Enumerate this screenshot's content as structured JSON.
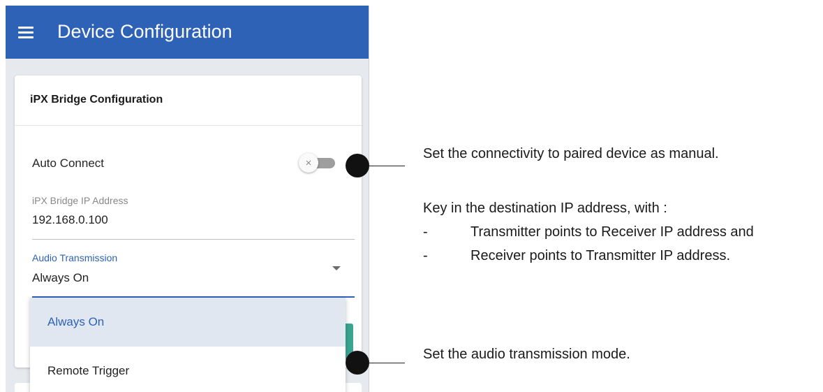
{
  "appbar": {
    "title": "Device Configuration",
    "menu_icon": "hamburger-menu-icon"
  },
  "card": {
    "title": "iPX Bridge Configuration",
    "auto_connect": {
      "label": "Auto Connect",
      "enabled": false,
      "knob_glyph": "×"
    },
    "ip_field": {
      "label": "iPX Bridge IP Address",
      "value": "192.168.0.100"
    },
    "audio_field": {
      "label": "Audio Transmission",
      "value": "Always On"
    }
  },
  "dropdown": {
    "options": [
      "Always On",
      "Remote Trigger"
    ],
    "selected": "Always On"
  },
  "callouts": {
    "note1": "Set the connectivity to paired device as manual.",
    "note2": "Key in the destination IP address, with :",
    "bullets": [
      {
        "dash": "-",
        "text": "Transmitter points to Receiver IP address and"
      },
      {
        "dash": "-",
        "text": "Receiver points to Transmitter IP address."
      }
    ],
    "note3": "Set the audio transmission mode."
  },
  "colors": {
    "primary": "#2e62b6",
    "accent_teal": "#3aa593",
    "background": "#e6eaef"
  }
}
